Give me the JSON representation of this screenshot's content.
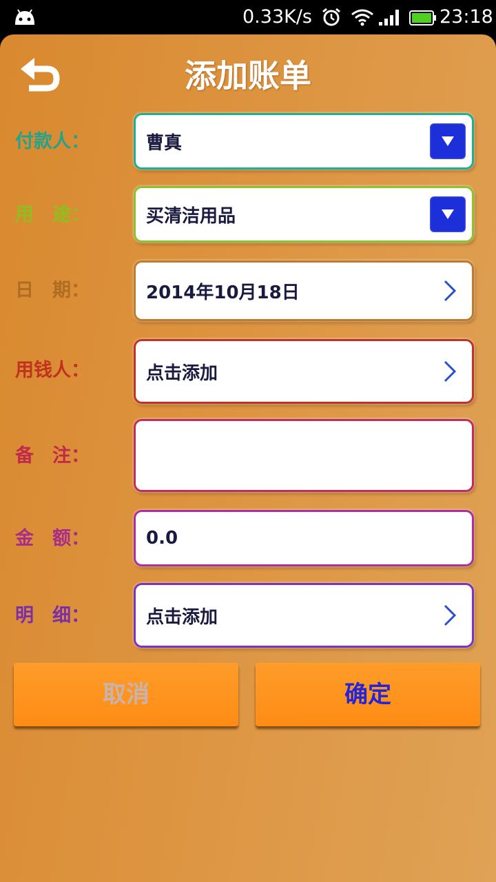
{
  "status_bar": {
    "speed": "0.33K/s",
    "time": "23:18",
    "icons": [
      "android-icon",
      "alarm-icon",
      "wifi-icon",
      "signal-icon",
      "battery-icon"
    ]
  },
  "header": {
    "title": "添加账单",
    "back_icon": "back-arrow-icon"
  },
  "form": {
    "payer": {
      "label": "付款人：",
      "value": "曹真",
      "label_color": "#25a38a",
      "border_color": "#20b090"
    },
    "purpose": {
      "label": "用　途：",
      "value": "买清洁用品",
      "label_color": "#8fbf1f",
      "border_color": "#8cc32a"
    },
    "date": {
      "label": "日　期：",
      "value": "2014年10月18日",
      "label_color": "#b06c22",
      "border_color": "#c07a2c"
    },
    "spender": {
      "label": "用钱人：",
      "value": "点击添加",
      "label_color": "#c0321e",
      "border_color": "#c43024"
    },
    "note": {
      "label": "备　注：",
      "value": "",
      "label_color": "#c02a4a",
      "border_color": "#c42a5a"
    },
    "amount": {
      "label": "金　额：",
      "value": "0.0",
      "label_color": "#a82c8a",
      "border_color": "#b02ca0"
    },
    "detail": {
      "label": "明　细：",
      "value": "点击添加",
      "label_color": "#7a2ea8",
      "border_color": "#8030c0"
    }
  },
  "buttons": {
    "cancel_label": "取消",
    "cancel_color": "#c7b4b0",
    "confirm_label": "确定",
    "confirm_color": "#2424d8"
  }
}
